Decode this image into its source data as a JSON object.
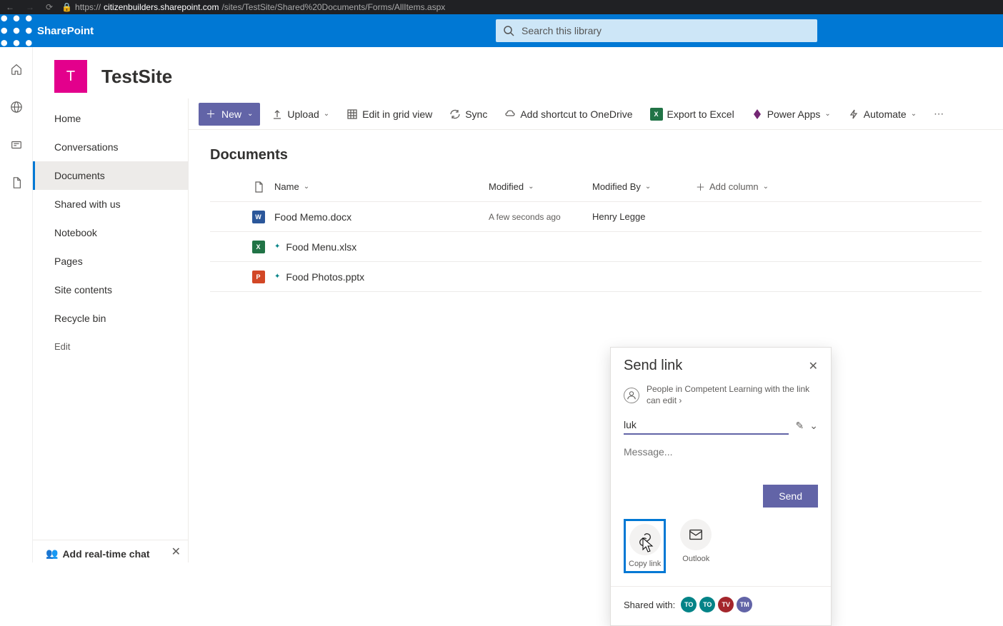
{
  "browser": {
    "url_prefix": "https://",
    "url_domain": "citizenbuilders.sharepoint.com",
    "url_path": "/sites/TestSite/Shared%20Documents/Forms/AllItems.aspx"
  },
  "suite": {
    "app_name": "SharePoint",
    "search_placeholder": "Search this library"
  },
  "site": {
    "logo_letter": "T",
    "title": "TestSite"
  },
  "nav": {
    "items": [
      "Home",
      "Conversations",
      "Documents",
      "Shared with us",
      "Notebook",
      "Pages",
      "Site contents",
      "Recycle bin"
    ],
    "active_index": 2,
    "edit": "Edit"
  },
  "chat_promo": {
    "title": "Add real-time chat"
  },
  "cmdbar": {
    "new": "New",
    "upload": "Upload",
    "grid": "Edit in grid view",
    "sync": "Sync",
    "shortcut": "Add shortcut to OneDrive",
    "excel": "Export to Excel",
    "powerapps": "Power Apps",
    "automate": "Automate"
  },
  "library": {
    "title": "Documents",
    "columns": {
      "name": "Name",
      "modified": "Modified",
      "by": "Modified By",
      "add": "Add column"
    },
    "rows": [
      {
        "icon": "word",
        "name": "Food Memo.docx",
        "new": false,
        "modified": "A few seconds ago",
        "by": "Henry Legge"
      },
      {
        "icon": "excel",
        "name": "Food Menu.xlsx",
        "new": true,
        "modified": "",
        "by": ""
      },
      {
        "icon": "ppt",
        "name": "Food Photos.pptx",
        "new": true,
        "modified": "",
        "by": ""
      }
    ]
  },
  "modal": {
    "title": "Send link",
    "scope": "People in Competent Learning with the link can edit",
    "recipient_value": "luk",
    "message_placeholder": "Message...",
    "send": "Send",
    "copy_link": "Copy link",
    "outlook": "Outlook",
    "shared_with": "Shared with:",
    "avatars": [
      {
        "text": "TO",
        "color": "#038387"
      },
      {
        "text": "TO",
        "color": "#038387"
      },
      {
        "text": "TV",
        "color": "#a4262c"
      },
      {
        "text": "TM",
        "color": "#6264a7"
      }
    ]
  }
}
